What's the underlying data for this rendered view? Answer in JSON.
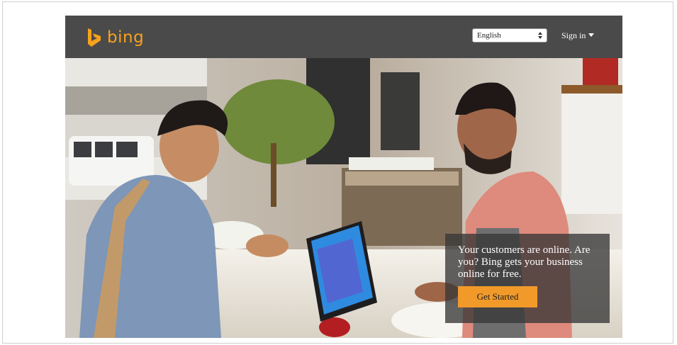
{
  "brand": {
    "name": "bing",
    "color": "#f7a21b",
    "logo_icon": "bing-b-logo-icon"
  },
  "header": {
    "language_select": {
      "value": "English",
      "icon": "select-updown-arrows-icon"
    },
    "sign_in": {
      "label": "Sign in",
      "icon": "caret-down-icon"
    }
  },
  "hero": {
    "image_description_icon": "coffee-shop-photo",
    "promo": {
      "text": "Your customers are online. Are you? Bing gets your business online for free.",
      "button_label": "Get Started",
      "button_color": "#f19a2a"
    }
  },
  "colors": {
    "topbar": "#4b4a4a",
    "page_border": "#cfcfcf"
  }
}
